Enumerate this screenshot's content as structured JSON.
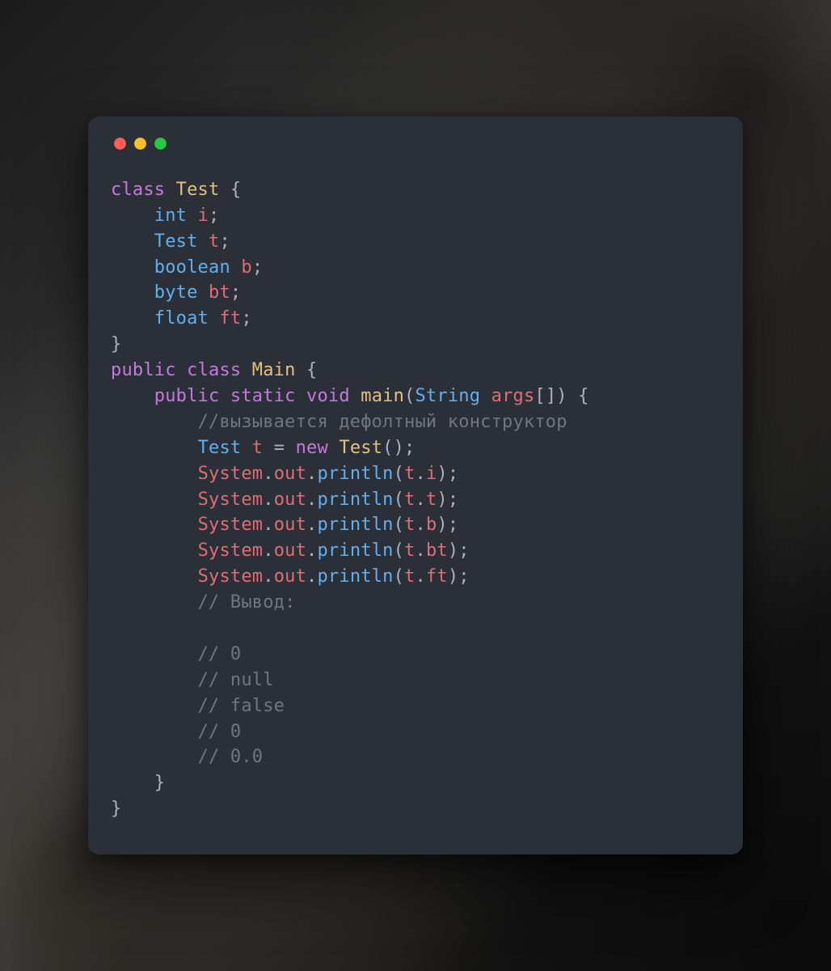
{
  "window": {
    "traffic_lights": {
      "red": "#ff5f56",
      "yellow": "#ffbd2e",
      "green": "#27c93f"
    }
  },
  "code": {
    "lines": [
      [
        [
          "kw",
          "class "
        ],
        [
          "class",
          "Test"
        ],
        [
          "punct",
          " {"
        ]
      ],
      [
        [
          "punct",
          "    "
        ],
        [
          "type",
          "int"
        ],
        [
          "punct",
          " "
        ],
        [
          "ident",
          "i"
        ],
        [
          "punct",
          ";"
        ]
      ],
      [
        [
          "punct",
          "    "
        ],
        [
          "type",
          "Test"
        ],
        [
          "punct",
          " "
        ],
        [
          "ident",
          "t"
        ],
        [
          "punct",
          ";"
        ]
      ],
      [
        [
          "punct",
          "    "
        ],
        [
          "type",
          "boolean"
        ],
        [
          "punct",
          " "
        ],
        [
          "ident",
          "b"
        ],
        [
          "punct",
          ";"
        ]
      ],
      [
        [
          "punct",
          "    "
        ],
        [
          "type",
          "byte"
        ],
        [
          "punct",
          " "
        ],
        [
          "ident",
          "bt"
        ],
        [
          "punct",
          ";"
        ]
      ],
      [
        [
          "punct",
          "    "
        ],
        [
          "type",
          "float"
        ],
        [
          "punct",
          " "
        ],
        [
          "ident",
          "ft"
        ],
        [
          "punct",
          ";"
        ]
      ],
      [
        [
          "punct",
          "}"
        ]
      ],
      [
        [
          "kw",
          "public "
        ],
        [
          "kw",
          "class "
        ],
        [
          "class",
          "Main"
        ],
        [
          "punct",
          " {"
        ]
      ],
      [
        [
          "punct",
          "    "
        ],
        [
          "kw",
          "public "
        ],
        [
          "kw",
          "static "
        ],
        [
          "void",
          "void "
        ],
        [
          "fn",
          "main"
        ],
        [
          "punct",
          "("
        ],
        [
          "type",
          "String"
        ],
        [
          "punct",
          " "
        ],
        [
          "ident",
          "args"
        ],
        [
          "punct",
          "[]) {"
        ]
      ],
      [
        [
          "punct",
          "        "
        ],
        [
          "comment",
          "//вызывается дефолтный конструктор"
        ]
      ],
      [
        [
          "punct",
          "        "
        ],
        [
          "type",
          "Test"
        ],
        [
          "punct",
          " "
        ],
        [
          "ident",
          "t"
        ],
        [
          "punct",
          " = "
        ],
        [
          "kw2",
          "new"
        ],
        [
          "punct",
          " "
        ],
        [
          "fn",
          "Test"
        ],
        [
          "punct",
          "();"
        ]
      ],
      [
        [
          "punct",
          "        "
        ],
        [
          "obj",
          "System"
        ],
        [
          "punct",
          "."
        ],
        [
          "prop",
          "out"
        ],
        [
          "punct",
          "."
        ],
        [
          "method",
          "println"
        ],
        [
          "punct",
          "("
        ],
        [
          "ident",
          "t"
        ],
        [
          "punct",
          "."
        ],
        [
          "ident",
          "i"
        ],
        [
          "punct",
          ");"
        ]
      ],
      [
        [
          "punct",
          "        "
        ],
        [
          "obj",
          "System"
        ],
        [
          "punct",
          "."
        ],
        [
          "prop",
          "out"
        ],
        [
          "punct",
          "."
        ],
        [
          "method",
          "println"
        ],
        [
          "punct",
          "("
        ],
        [
          "ident",
          "t"
        ],
        [
          "punct",
          "."
        ],
        [
          "ident",
          "t"
        ],
        [
          "punct",
          ");"
        ]
      ],
      [
        [
          "punct",
          "        "
        ],
        [
          "obj",
          "System"
        ],
        [
          "punct",
          "."
        ],
        [
          "prop",
          "out"
        ],
        [
          "punct",
          "."
        ],
        [
          "method",
          "println"
        ],
        [
          "punct",
          "("
        ],
        [
          "ident",
          "t"
        ],
        [
          "punct",
          "."
        ],
        [
          "ident",
          "b"
        ],
        [
          "punct",
          ");"
        ]
      ],
      [
        [
          "punct",
          "        "
        ],
        [
          "obj",
          "System"
        ],
        [
          "punct",
          "."
        ],
        [
          "prop",
          "out"
        ],
        [
          "punct",
          "."
        ],
        [
          "method",
          "println"
        ],
        [
          "punct",
          "("
        ],
        [
          "ident",
          "t"
        ],
        [
          "punct",
          "."
        ],
        [
          "ident",
          "bt"
        ],
        [
          "punct",
          ");"
        ]
      ],
      [
        [
          "punct",
          "        "
        ],
        [
          "obj",
          "System"
        ],
        [
          "punct",
          "."
        ],
        [
          "prop",
          "out"
        ],
        [
          "punct",
          "."
        ],
        [
          "method",
          "println"
        ],
        [
          "punct",
          "("
        ],
        [
          "ident",
          "t"
        ],
        [
          "punct",
          "."
        ],
        [
          "ident",
          "ft"
        ],
        [
          "punct",
          ");"
        ]
      ],
      [
        [
          "punct",
          "        "
        ],
        [
          "comment",
          "// Вывод:"
        ]
      ],
      [
        [
          "punct",
          ""
        ]
      ],
      [
        [
          "punct",
          "        "
        ],
        [
          "comment",
          "// 0"
        ]
      ],
      [
        [
          "punct",
          "        "
        ],
        [
          "comment",
          "// null"
        ]
      ],
      [
        [
          "punct",
          "        "
        ],
        [
          "comment",
          "// false"
        ]
      ],
      [
        [
          "punct",
          "        "
        ],
        [
          "comment",
          "// 0"
        ]
      ],
      [
        [
          "punct",
          "        "
        ],
        [
          "comment",
          "// 0.0"
        ]
      ],
      [
        [
          "punct",
          "    }"
        ]
      ],
      [
        [
          "punct",
          "}"
        ]
      ]
    ]
  }
}
